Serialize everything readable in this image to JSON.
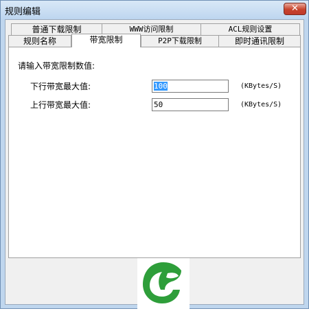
{
  "window": {
    "title": "规则编辑",
    "close_glyph": "✕"
  },
  "tabs": {
    "row1": [
      "普通下载限制",
      "WWW访问限制",
      "ACL规则设置"
    ],
    "row2": [
      "规则名称",
      "带宽限制",
      "P2P下载限制",
      "即时通讯限制"
    ],
    "selected": "带宽限制"
  },
  "bandwidth": {
    "prompt": "请输入带宽限制数值:",
    "download_label": "下行带宽最大值:",
    "download_value": "100",
    "upload_label": "上行带宽最大值:",
    "upload_value": "50",
    "unit": "(KBytes/S)"
  },
  "colors": {
    "logo_green": "#2e9e3a",
    "selection": "#3399ff",
    "close_red": "#c7432c"
  }
}
